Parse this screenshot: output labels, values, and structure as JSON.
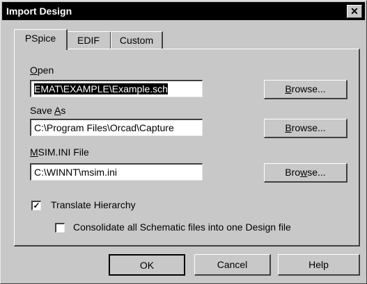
{
  "window": {
    "title": "Import Design",
    "close_glyph": "✕"
  },
  "tabs": [
    {
      "label": "PSpice",
      "active": true
    },
    {
      "label": "EDIF",
      "active": false
    },
    {
      "label": "Custom",
      "active": false
    }
  ],
  "open": {
    "label": "Open",
    "value": "EMAT\\EXAMPLE\\Example.sch",
    "browse": "Browse..."
  },
  "save_as": {
    "label": "Save As",
    "value": "C:\\Program Files\\Orcad\\Capture",
    "browse": "Browse..."
  },
  "msim": {
    "label": "MSIM.INI File",
    "value": "C:\\WINNT\\msim.ini",
    "browse": "Browse..."
  },
  "translate_hierarchy": {
    "label": "Translate Hierarchy",
    "checked": true,
    "mark": "✓"
  },
  "consolidate": {
    "label": "Consolidate all Schematic files into one Design file",
    "checked": false
  },
  "footer": {
    "ok": "OK",
    "cancel": "Cancel",
    "help": "Help"
  }
}
